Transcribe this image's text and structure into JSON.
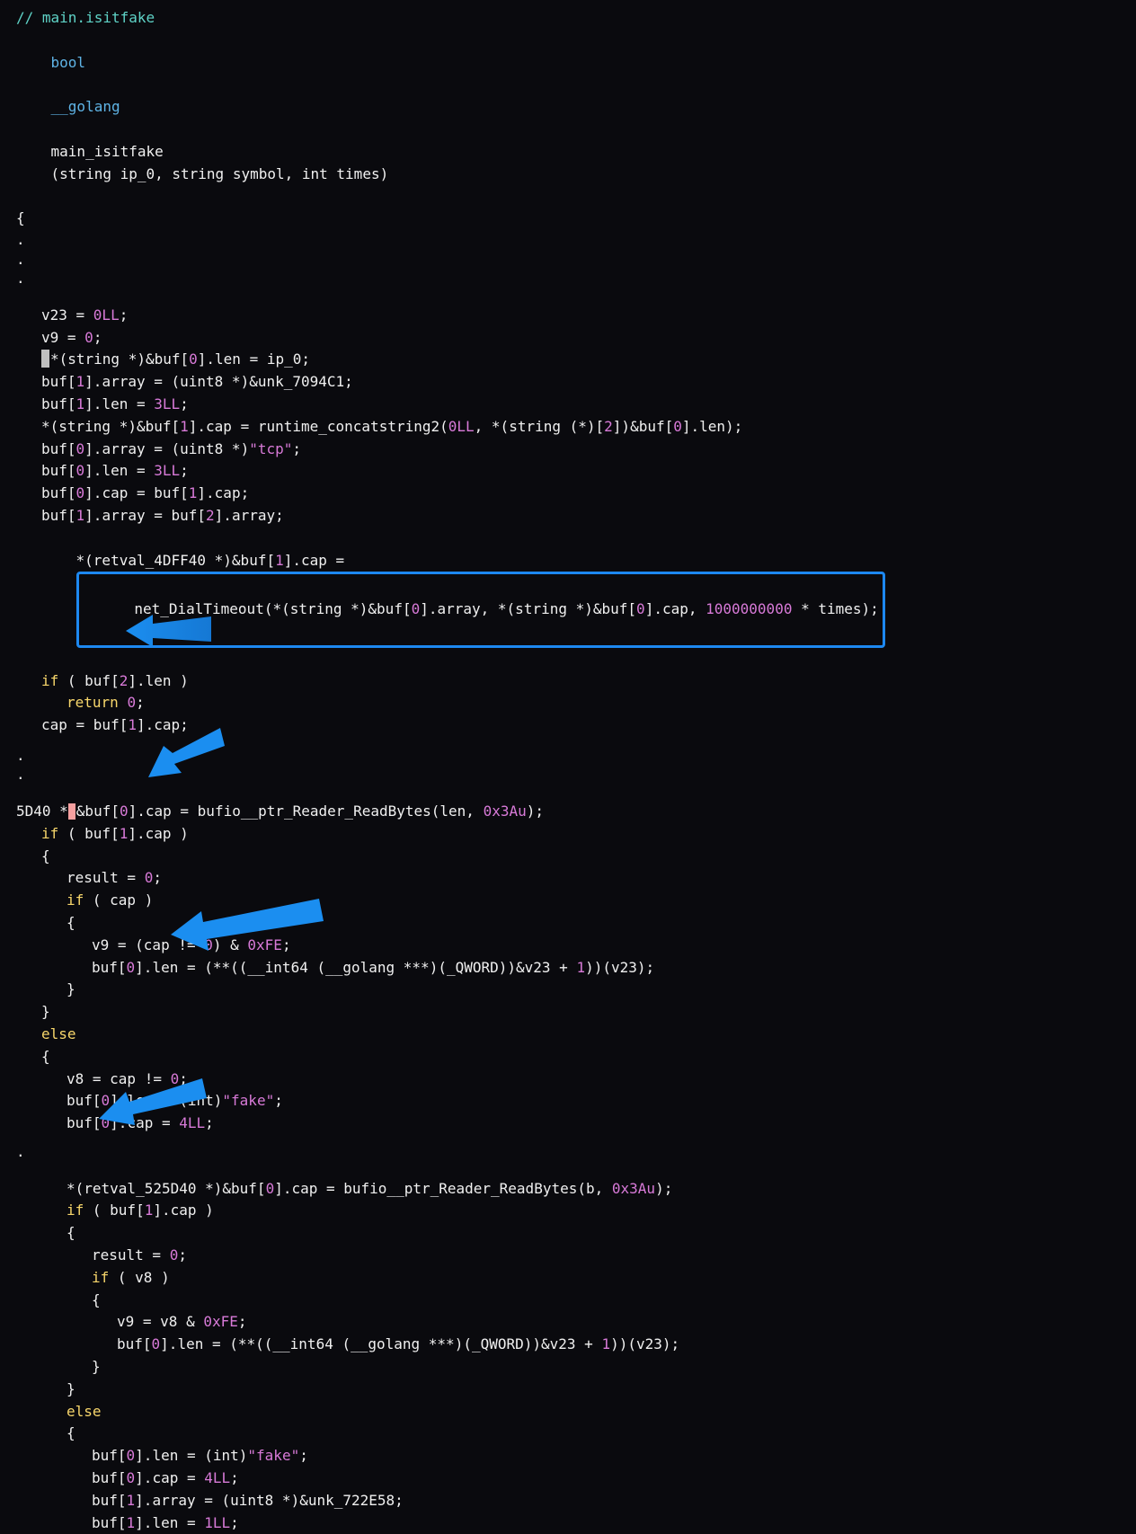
{
  "comment": "// main.isitfake",
  "signature": {
    "ret_type": "bool",
    "cc": "__golang",
    "name": "main_isitfake",
    "params": "(string ip_0, string symbol, int times)"
  },
  "open_brace": "{",
  "dot": ".",
  "lines": {
    "l1": "v23 = ",
    "l1n": "0LL",
    "l1e": ";",
    "l2": "v9 = ",
    "l2n": "0",
    "l2e": ";",
    "l3a": "*(string *)&buf[",
    "l3i": "0",
    "l3b": "].len = ip_0;",
    "l4a": "buf[",
    "l4i": "1",
    "l4b": "].array = (uint8 *)&unk_7094C1;",
    "l5a": "buf[",
    "l5i": "1",
    "l5b": "].len = ",
    "l5n": "3LL",
    "l5e": ";",
    "l6a": "*(string *)&buf[",
    "l6i": "1",
    "l6b": "].cap = runtime_concatstring2(",
    "l6n": "0LL",
    "l6c": ", *(string (*)[",
    "l6n2": "2",
    "l6d": "])&buf[",
    "l6i2": "0",
    "l6e": "].len);",
    "l7a": "buf[",
    "l7i": "0",
    "l7b": "].array = (uint8 *)",
    "l7s": "\"tcp\"",
    "l7e": ";",
    "l8a": "buf[",
    "l8i": "0",
    "l8b": "].len = ",
    "l8n": "3LL",
    "l8e": ";",
    "l9a": "buf[",
    "l9i": "0",
    "l9b": "].cap = buf[",
    "l9i2": "1",
    "l9c": "].cap;",
    "l10a": "buf[",
    "l10i": "1",
    "l10b": "].array = buf[",
    "l10i2": "2",
    "l10c": "].array;",
    "l11a": "*(retval_4DFF40 *)&buf[",
    "l11i": "1",
    "l11b": "].cap = ",
    "l11_boxed_a": "net_DialTimeout(*(string *)&buf[",
    "l11_bi0": "0",
    "l11_boxed_b": "].array, *(string *)&buf[",
    "l11_bi1": "0",
    "l11_boxed_c": "].cap, ",
    "l11_bn": "1000000000",
    "l11_boxed_d": " * times);",
    "l12a": "if",
    "l12b": " ( buf[",
    "l12i": "2",
    "l12c": "].len )",
    "l13a": "return",
    "l13b": " ",
    "l13n": "0",
    "l13e": ";",
    "l14a": "cap = buf[",
    "l14i": "1",
    "l14b": "].cap;",
    "s2a": "5D40 *",
    "s2b": "&buf[",
    "s2i": "0",
    "s2c": "].cap = bufio__ptr_Reader_ReadBytes(len, ",
    "s2n": "0x3Au",
    "s2e": ");",
    "s3a": "if",
    "s3b": " ( buf[",
    "s3i": "1",
    "s3c": "].cap )",
    "s3o": "{",
    "s4a": "result = ",
    "s4n": "0",
    "s4e": ";",
    "s5a": "if",
    "s5b": " ( cap )",
    "s5o": "{",
    "s6a": "v9 = (cap != ",
    "s6n": "0",
    "s6b": ") & ",
    "s6n2": "0xFE",
    "s6e": ";",
    "s7a": "buf[",
    "s7i": "0",
    "s7b": "].len = (**((__int64 (__golang ***)(_QWORD))&v23 + ",
    "s7n": "1",
    "s7c": "))(v23);",
    "cb": "}",
    "else": "else",
    "ob": "{",
    "s8a": "v8 = cap != ",
    "s8n": "0",
    "s8e": ";",
    "s9a": "buf[",
    "s9i": "0",
    "s9b": "].len = (int)",
    "s9s": "\"fake\"",
    "s9e": ";",
    "s10a": "buf[",
    "s10i": "0",
    "s10b": "].cap = ",
    "s10n": "4LL",
    "s10e": ";",
    "t1a": "*(retval_525D40 *)&buf[",
    "t1i": "0",
    "t1b": "].cap = bufio__ptr_Reader_ReadBytes(b, ",
    "t1n": "0x3Au",
    "t1e": ");",
    "t2a": "if",
    "t2b": " ( buf[",
    "t2i": "1",
    "t2c": "].cap )",
    "t3a": "result = ",
    "t3n": "0",
    "t3e": ";",
    "t4a": "if",
    "t4b": " ( v8 )",
    "t5a": "v9 = v8 & ",
    "t5n": "0xFE",
    "t5e": ";",
    "t6a": "buf[",
    "t6i": "0",
    "t6b": "].len = (**((__int64 (__golang ***)(_QWORD))&v23 + ",
    "t6n": "1",
    "t6c": "))(v23);",
    "u1a": "buf[",
    "u1i": "0",
    "u1b": "].len = (int)",
    "u1s": "\"fake\"",
    "u1e": ";",
    "u2a": "buf[",
    "u2i": "0",
    "u2b": "].cap = ",
    "u2n": "4LL",
    "u2e": ";",
    "u3a": "buf[",
    "u3i": "1",
    "u3b": "].array = (uint8 *)&unk_722E58;",
    "u4a": "buf[",
    "u4i": "1",
    "u4b": "].len = ",
    "u4n": "1LL",
    "u4e": ";"
  }
}
